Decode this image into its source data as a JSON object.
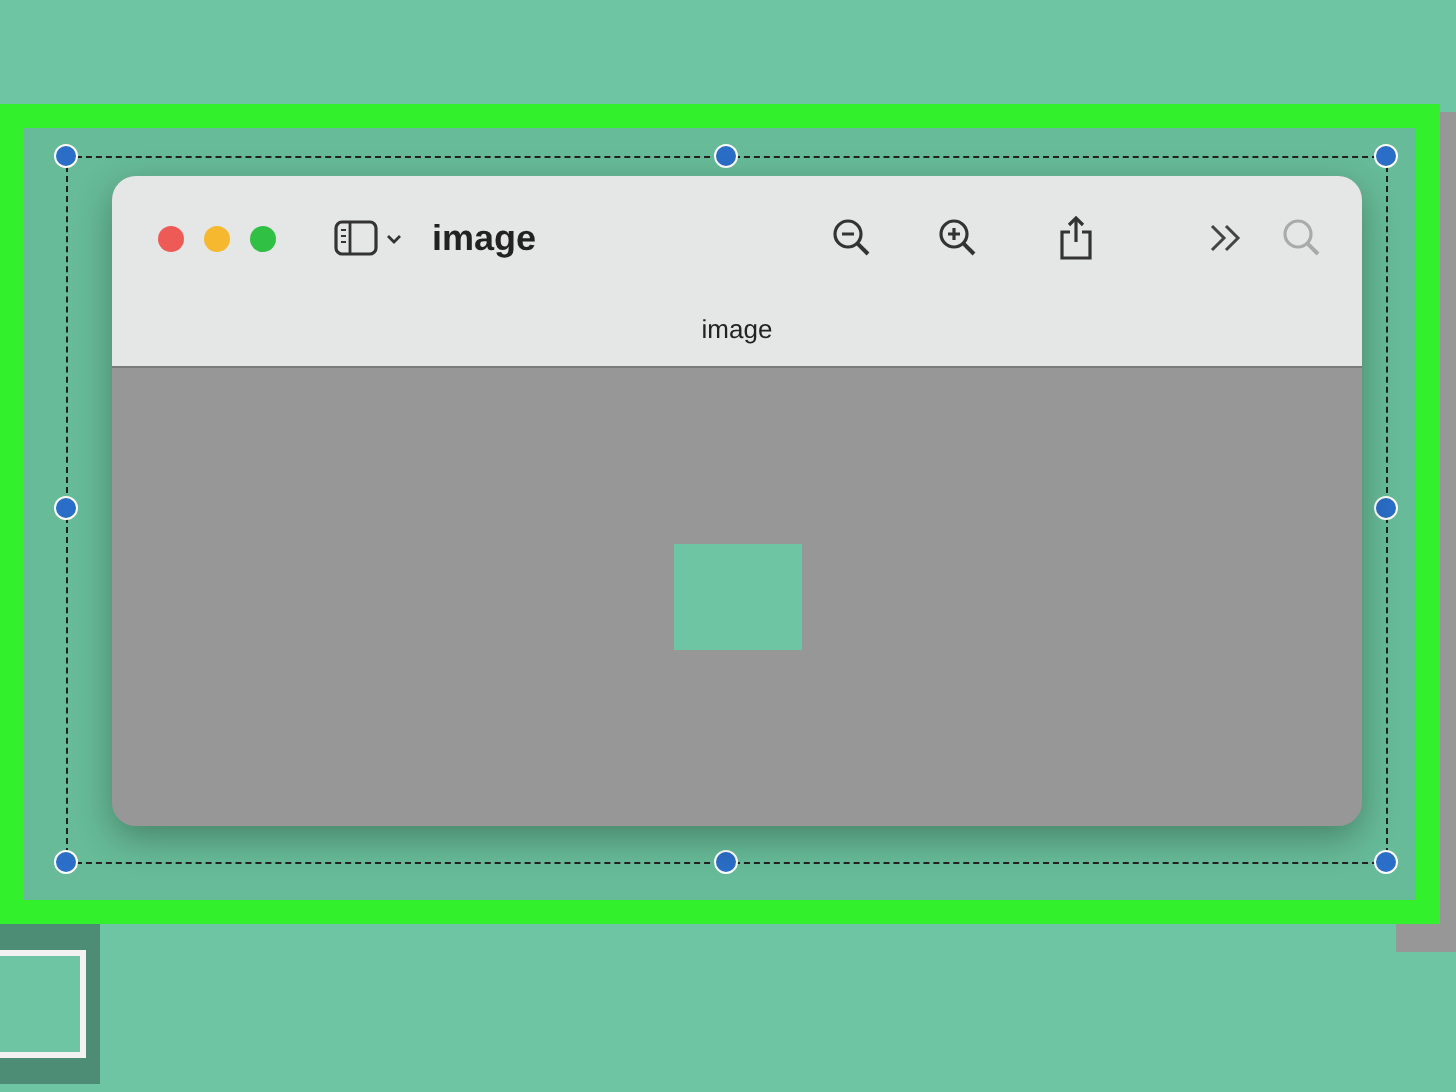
{
  "window": {
    "title": "image",
    "subtitle": "image"
  }
}
